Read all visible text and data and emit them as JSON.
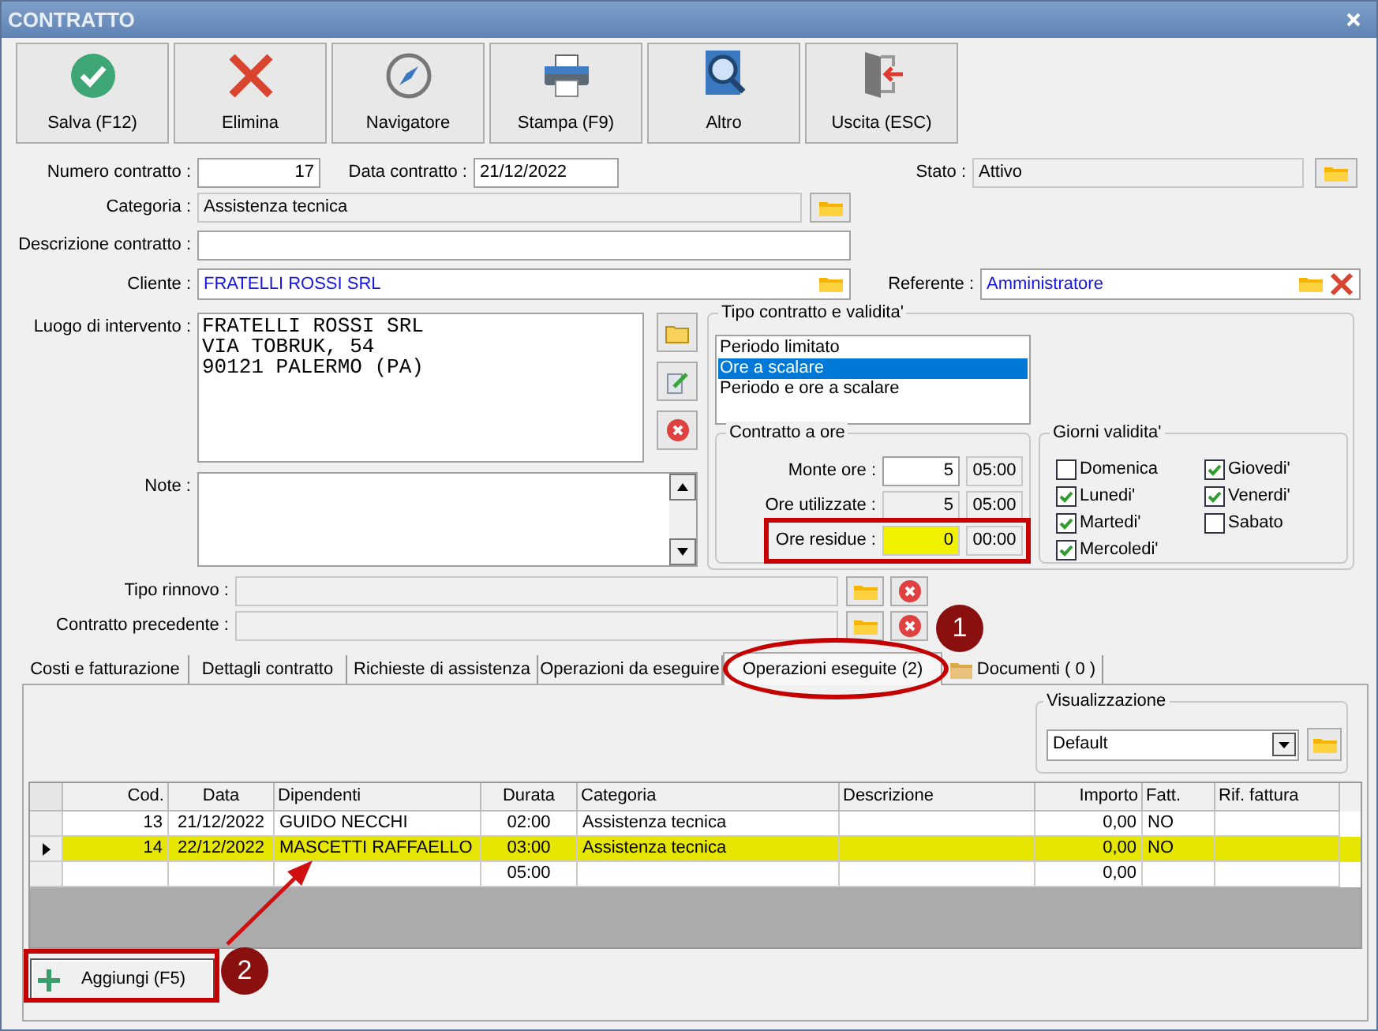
{
  "window": {
    "title": "CONTRATTO"
  },
  "toolbar": [
    {
      "label": "Salva (F12)",
      "kind": "save"
    },
    {
      "label": "Elimina",
      "kind": "delete"
    },
    {
      "label": "Navigatore",
      "kind": "navigator"
    },
    {
      "label": "Stampa (F9)",
      "kind": "print"
    },
    {
      "label": "Altro",
      "kind": "search"
    },
    {
      "label": "Uscita (ESC)",
      "kind": "exit"
    }
  ],
  "numero_contratto": {
    "label": "Numero contratto :",
    "value": "17"
  },
  "data_contratto": {
    "label": "Data contratto :",
    "value": "21/12/2022"
  },
  "stato": {
    "label": "Stato :",
    "value": "Attivo"
  },
  "categoria": {
    "label": "Categoria :",
    "value": "Assistenza tecnica"
  },
  "descrizione_contratto": {
    "label": "Descrizione contratto :"
  },
  "cliente": {
    "label": "Cliente :",
    "value": "FRATELLI ROSSI SRL"
  },
  "referente": {
    "label": "Referente :",
    "value": "Amministratore"
  },
  "luogo_intervento": {
    "label": "Luogo di intervento :",
    "lines": [
      "FRATELLI ROSSI SRL",
      "VIA TOBRUK, 54",
      "90121 PALERMO (PA)"
    ]
  },
  "note": {
    "label": "Note :"
  },
  "tipo_contratto": {
    "title": "Tipo contratto e validita'",
    "options": [
      {
        "label": "Periodo limitato",
        "selected": false
      },
      {
        "label": "Ore a scalare",
        "selected": true
      },
      {
        "label": "Periodo e ore a scalare",
        "selected": false
      }
    ]
  },
  "contratto_a_ore": {
    "title": "Contratto a ore",
    "rows": [
      {
        "label": "Monte ore :",
        "value": "5",
        "time": "05:00",
        "kind": "editable"
      },
      {
        "label": "Ore utilizzate :",
        "value": "5",
        "time": "05:00",
        "kind": "readonly"
      },
      {
        "label": "Ore residue :",
        "value": "0",
        "time": "00:00",
        "kind": "highlight"
      }
    ]
  },
  "giorni_validita": {
    "title": "Giorni validita'",
    "days": [
      {
        "label": "Domenica",
        "checked": false
      },
      {
        "label": "Lunedi'",
        "checked": true
      },
      {
        "label": "Martedi'",
        "checked": true
      },
      {
        "label": "Mercoledi'",
        "checked": true
      },
      {
        "label": "Giovedi'",
        "checked": true
      },
      {
        "label": "Venerdi'",
        "checked": true
      },
      {
        "label": "Sabato",
        "checked": false
      }
    ]
  },
  "tipo_rinnovo": {
    "label": "Tipo rinnovo :"
  },
  "contratto_precedente": {
    "label": "Contratto precedente :"
  },
  "tabs": [
    {
      "label": "Costi e fatturazione",
      "selected": false,
      "kind": "plain"
    },
    {
      "label": "Dettagli contratto",
      "selected": false,
      "kind": "plain"
    },
    {
      "label": "Richieste di assistenza",
      "selected": false,
      "kind": "plain"
    },
    {
      "label": "Operazioni da eseguire",
      "selected": false,
      "kind": "plain"
    },
    {
      "label": "Operazioni eseguite (2)",
      "selected": true,
      "kind": "plain"
    },
    {
      "label": "Documenti ( 0 )",
      "selected": false,
      "kind": "folder"
    }
  ],
  "visualizzazione": {
    "title": "Visualizzazione",
    "value": "Default"
  },
  "table": {
    "columns": [
      "Cod.",
      "Data",
      "Dipendenti",
      "Durata",
      "Categoria",
      "Descrizione",
      "Importo",
      "Fatt.",
      "Rif. fattura"
    ],
    "rows": [
      {
        "kind": "data",
        "selected": false,
        "cells": [
          "13",
          "21/12/2022",
          "GUIDO NECCHI",
          "02:00",
          "Assistenza tecnica",
          "",
          "0,00",
          "NO",
          ""
        ]
      },
      {
        "kind": "data",
        "selected": true,
        "cells": [
          "14",
          "22/12/2022",
          "MASCETTI RAFFAELLO",
          "03:00",
          "Assistenza tecnica",
          "",
          "0,00",
          "NO",
          ""
        ]
      },
      {
        "kind": "total",
        "selected": false,
        "cells": [
          "",
          "",
          "",
          "05:00",
          "",
          "",
          "0,00",
          "",
          ""
        ]
      }
    ]
  },
  "add_button": {
    "label": "Aggiungi (F5)"
  },
  "step_badges": [
    "1",
    "2"
  ]
}
